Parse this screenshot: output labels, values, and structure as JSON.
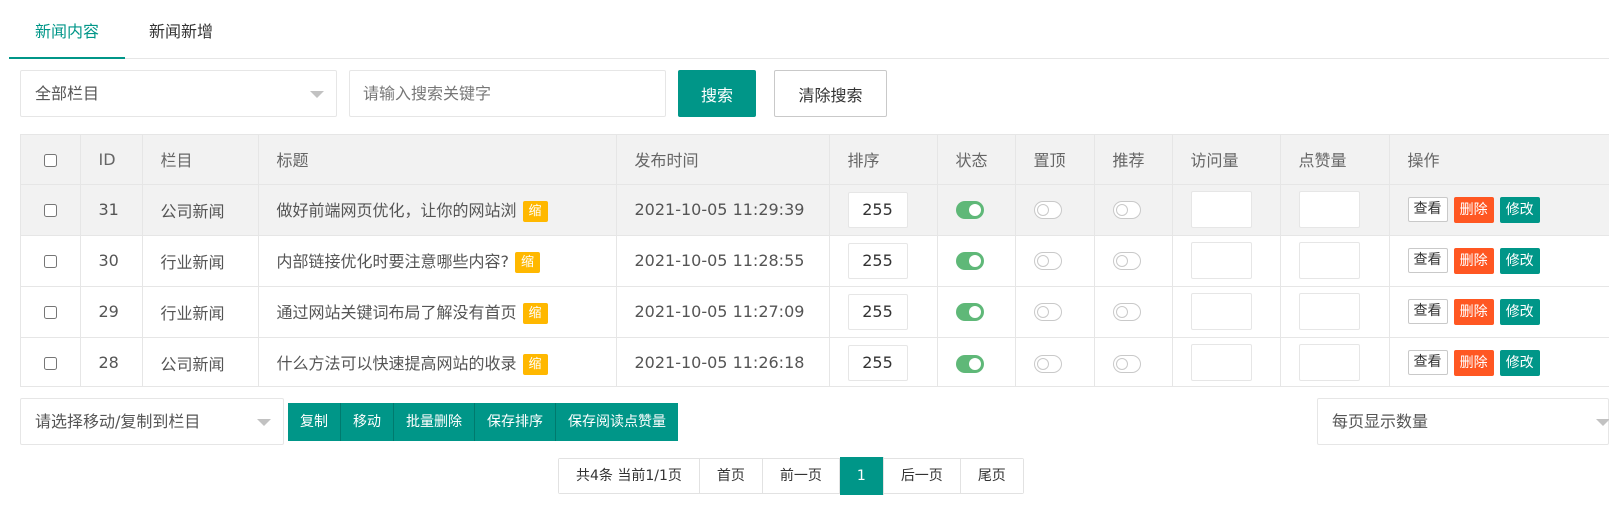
{
  "tabs": [
    {
      "label": "新闻内容",
      "active": true
    },
    {
      "label": "新闻新增",
      "active": false
    }
  ],
  "search": {
    "category_select": "全部栏目",
    "keyword_placeholder": "请输入搜索关键字",
    "search_button": "搜索",
    "clear_button": "清除搜索"
  },
  "table": {
    "headers": {
      "id": "ID",
      "category": "栏目",
      "title": "标题",
      "publish_time": "发布时间",
      "sort": "排序",
      "status": "状态",
      "top": "置顶",
      "recommend": "推荐",
      "views": "访问量",
      "likes": "点赞量",
      "actions": "操作"
    },
    "badge_label": "缩",
    "action_labels": {
      "view": "查看",
      "delete": "删除",
      "edit": "修改"
    },
    "rows": [
      {
        "id": "31",
        "category": "公司新闻",
        "title": "做好前端网页优化，让你的网站浏",
        "publish_time": "2021-10-05 11:29:39",
        "sort": "255",
        "status": true,
        "top": false,
        "recommend": false,
        "views": "",
        "likes": ""
      },
      {
        "id": "30",
        "category": "行业新闻",
        "title": "内部链接优化时要注意哪些内容?",
        "publish_time": "2021-10-05 11:28:55",
        "sort": "255",
        "status": true,
        "top": false,
        "recommend": false,
        "views": "",
        "likes": ""
      },
      {
        "id": "29",
        "category": "行业新闻",
        "title": "通过网站关键词布局了解没有首页",
        "publish_time": "2021-10-05 11:27:09",
        "sort": "255",
        "status": true,
        "top": false,
        "recommend": false,
        "views": "",
        "likes": ""
      },
      {
        "id": "28",
        "category": "公司新闻",
        "title": "什么方法可以快速提高网站的收录",
        "publish_time": "2021-10-05 11:26:18",
        "sort": "255",
        "status": true,
        "top": false,
        "recommend": false,
        "views": "",
        "likes": ""
      }
    ]
  },
  "bulk": {
    "move_select": "请选择移动/复制到栏目",
    "copy": "复制",
    "move": "移动",
    "batch_delete": "批量删除",
    "save_sort": "保存排序",
    "save_views_likes": "保存阅读点赞量",
    "page_size_select": "每页显示数量"
  },
  "pagination": {
    "summary": "共4条 当前1/1页",
    "first": "首页",
    "prev": "前一页",
    "current": "1",
    "next": "后一页",
    "last": "尾页"
  },
  "colors": {
    "primary": "#009688",
    "danger": "#ff5722",
    "warning": "#ffb800",
    "switch_on": "#5fb878"
  }
}
